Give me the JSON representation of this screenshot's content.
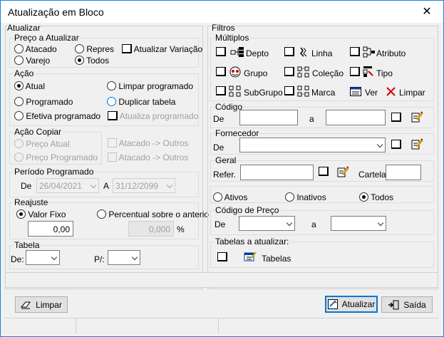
{
  "window": {
    "title": "Atualização em Bloco",
    "close": "✕"
  },
  "left": {
    "atualizar": {
      "legend": "Atualizar"
    },
    "preco": {
      "legend": "Preço a Atualizar",
      "atacado": "Atacado",
      "repres": "Repres",
      "atualizar_variacao": "Atualizar Variação",
      "varejo": "Varejo",
      "todos": "Todos"
    },
    "acao": {
      "legend": "Ação",
      "atual": "Atual",
      "limpar_programado": "Limpar programado",
      "programado": "Programado",
      "duplicar_tabela": "Duplicar tabela",
      "efetiva_programado": "Efetiva programado",
      "atualiza_programado": "Atualiza programado"
    },
    "acao_copiar": {
      "legend": "Ação Copiar",
      "preco_atual": "Preço Atual",
      "preco_programado": "Preço Programado",
      "atacado_outros_1": "Atacado -> Outros",
      "atacado_outros_2": "Atacado -> Outros"
    },
    "periodo": {
      "legend": "Período Programado",
      "de_label": "De",
      "de_value": "26/04/2021",
      "a_label": "A",
      "a_value": "31/12/2099"
    },
    "reajuste": {
      "legend": "Reajuste",
      "valor_fixo": "Valor Fixo",
      "percentual": "Percentual sobre o anterio",
      "valor": "0,00",
      "percent_value": "0,000",
      "percent_sign": "%"
    },
    "tabela": {
      "legend": "Tabela",
      "de_label": "De:",
      "p_label": "P/:"
    }
  },
  "right": {
    "filtros": {
      "legend": "Filtros"
    },
    "multiplos": {
      "legend": "Múltiplos",
      "depto": "Depto",
      "linha": "Linha",
      "atributo": "Atributo",
      "grupo": "Grupo",
      "colecao": "Coleção",
      "tipo": "Tipo",
      "subgrupo": "SubGrupo",
      "marca": "Marca",
      "ver": "Ver",
      "limpar": "Limpar"
    },
    "codigo": {
      "legend": "Código",
      "de_label": "De",
      "a_label": "a"
    },
    "fornecedor": {
      "legend": "Fornecedor",
      "de_label": "De"
    },
    "geral": {
      "legend": "Geral",
      "refer_label": "Refer.",
      "cartela_label": "Cartela"
    },
    "status": {
      "ativos": "Ativos",
      "inativos": "Inativos",
      "todos": "Todos"
    },
    "codigo_preco": {
      "legend": "Código de Preço",
      "de_label": "De",
      "a_label": "a"
    },
    "tabelas": {
      "legend": "Tabelas a atualizar:",
      "tabelas": "Tabelas"
    }
  },
  "footer": {
    "limpar": "Limpar",
    "atualizar": "Atualizar",
    "saida": "Saída"
  },
  "colors": {
    "accent": "#0078d7",
    "window_border": "#1883d7"
  }
}
